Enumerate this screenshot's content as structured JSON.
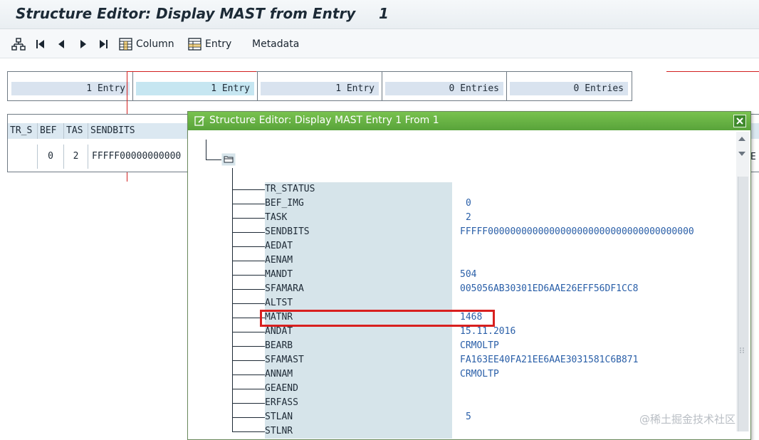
{
  "window": {
    "title": "Structure Editor: Display MAST from Entry",
    "entry_number": "1"
  },
  "toolbar": {
    "column_label": "Column",
    "entry_label": "Entry",
    "metadata_label": "Metadata"
  },
  "counts": [
    "1 Entry",
    "1 Entry",
    "1 Entry",
    "0 Entries",
    "0 Entries"
  ],
  "bg_table": {
    "headers": [
      "TR_S",
      "BEF",
      "TAS",
      "SENDBITS"
    ],
    "row": [
      "",
      "0",
      "2",
      "FFFFF00000000000"
    ],
    "right_fragment": "E"
  },
  "popup": {
    "title": "Structure Editor: Display MAST Entry 1 From 1",
    "fields": [
      {
        "name": "TR_STATUS",
        "value": ""
      },
      {
        "name": "BEF_IMG",
        "value": "0"
      },
      {
        "name": "TASK",
        "value": "2"
      },
      {
        "name": "SENDBITS",
        "value": "FFFFF0000000000000000000000000000000000000"
      },
      {
        "name": "AEDAT",
        "value": ""
      },
      {
        "name": "AENAM",
        "value": ""
      },
      {
        "name": "MANDT",
        "value": "504"
      },
      {
        "name": "SFAMARA",
        "value": "005056AB30301ED6AAE26EFF56DF1CC8"
      },
      {
        "name": "ALTST",
        "value": ""
      },
      {
        "name": "MATNR",
        "value": "1468"
      },
      {
        "name": "ANDAT",
        "value": "15.11.2016"
      },
      {
        "name": "BEARB",
        "value": "CRMOLTP"
      },
      {
        "name": "SFAMAST",
        "value": "FA163EE40FA21EE6AAE3031581C6B871"
      },
      {
        "name": "ANNAM",
        "value": "CRMOLTP"
      },
      {
        "name": "GEAEND",
        "value": ""
      },
      {
        "name": "ERFASS",
        "value": ""
      },
      {
        "name": "STLAN",
        "value": "5"
      },
      {
        "name": "STLNR",
        "value": ""
      }
    ]
  },
  "watermark": "@稀土掘金技术社区",
  "colors": {
    "popup_title": "#58a33a",
    "field_value": "#2a5fa8",
    "highlight": "#d8201f"
  }
}
